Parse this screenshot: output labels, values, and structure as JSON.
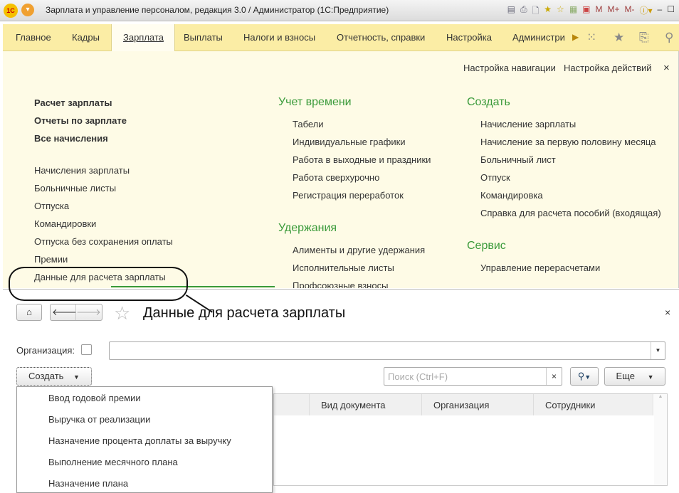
{
  "window": {
    "title": "Зарплата и управление персоналом, редакция 3.0 / Администратор  (1С:Предприятие)",
    "logo": "1С",
    "toolbar_icons": [
      "save-icon",
      "print-icon",
      "preview-icon",
      "favorites-add-icon",
      "favorites-icon",
      "calculator-icon",
      "calendar-icon",
      "M",
      "M+",
      "M-",
      "info-icon",
      "minimize-icon",
      "maximize-icon"
    ]
  },
  "menu": {
    "items": [
      "Главное",
      "Кадры",
      "Зарплата",
      "Выплаты",
      "Налоги и взносы",
      "Отчетность, справки",
      "Настройка",
      "Администри"
    ],
    "active": "Зарплата"
  },
  "panel": {
    "nav_settings": "Настройка навигации",
    "action_settings": "Настройка действий",
    "close": "×",
    "col1_bold": [
      "Расчет зарплаты",
      "Отчеты по зарплате",
      "Все начисления"
    ],
    "col1": [
      "Начисления зарплаты",
      "Больничные листы",
      "Отпуска",
      "Командировки",
      "Отпуска без сохранения оплаты",
      "Премии",
      "Данные для расчета зарплаты"
    ],
    "time_title": "Учет времени",
    "time": [
      "Табели",
      "Индивидуальные графики",
      "Работа в выходные и праздники",
      "Работа сверхурочно",
      "Регистрация переработок"
    ],
    "ded_title": "Удержания",
    "ded": [
      "Алименты и другие удержания",
      "Исполнительные листы",
      "Профсоюзные взносы"
    ],
    "create_title": "Создать",
    "create": [
      "Начисление зарплаты",
      "Начисление за первую половину месяца",
      "Больничный лист",
      "Отпуск",
      "Командировка",
      "Справка для расчета пособий (входящая)"
    ],
    "service_title": "Сервис",
    "service": [
      "Управление перерасчетами"
    ]
  },
  "form": {
    "title": "Данные для расчета зарплаты",
    "close": "×",
    "org_label": "Организация:",
    "org_value": "",
    "create_btn": "Создать",
    "search_placeholder": "Поиск (Ctrl+F)",
    "search_clear": "×",
    "more_btn": "Еще",
    "columns": [
      "",
      "Вид документа",
      "Организация",
      "Сотрудники"
    ],
    "create_menu": [
      "Ввод годовой премии",
      "Выручка от реализации",
      "Назначение процента доплаты за выручку",
      "Выполнение месячного плана",
      "Назначение плана"
    ]
  }
}
